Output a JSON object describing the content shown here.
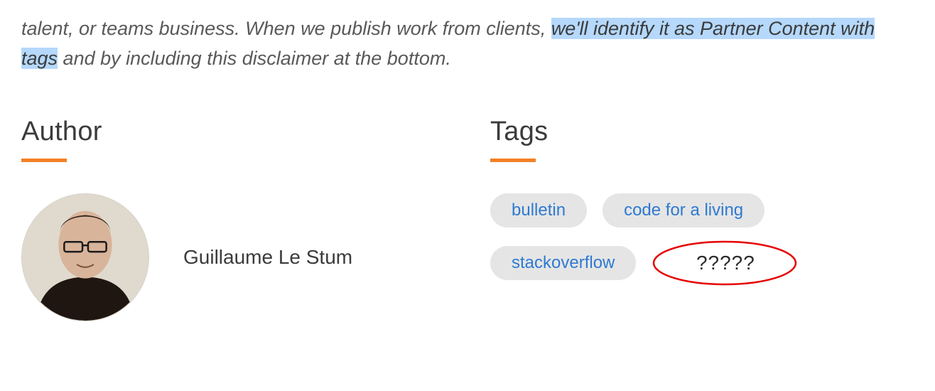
{
  "disclaimer": {
    "part1": "talent, or teams business. When we publish work from clients, ",
    "highlighted": "we'll identify it as Partner Content with tags",
    "part2": " and by including this disclaimer at the bottom."
  },
  "sections": {
    "author_heading": "Author",
    "tags_heading": "Tags"
  },
  "author": {
    "name": "Guillaume Le Stum"
  },
  "tags": {
    "items": [
      "bulletin",
      "code for a living",
      "stackoverflow"
    ]
  },
  "annotation": {
    "text": "?????"
  },
  "colors": {
    "accent": "#f48024",
    "highlight": "#b5d8fb",
    "tag_bg": "#e5e5e5",
    "tag_fg": "#2e7ad1",
    "annotation_stroke": "#e60000"
  }
}
